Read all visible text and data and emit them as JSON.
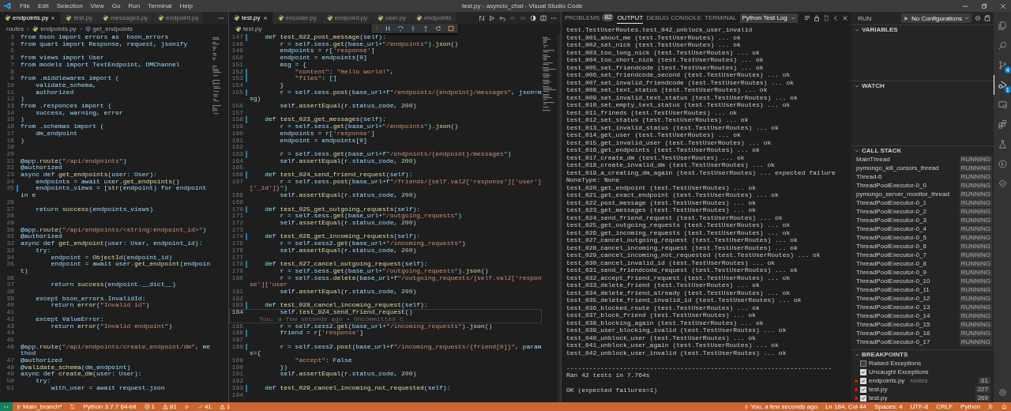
{
  "title_bar": {
    "menu": [
      "File",
      "Edit",
      "Selection",
      "View",
      "Go",
      "Run",
      "Terminal",
      "Help"
    ],
    "title": "test.py - asyncio_chat - Visual Studio Code"
  },
  "editor_groups": [
    {
      "tabs": [
        {
          "label": "endpoints.py",
          "selected": true
        },
        {
          "label": "test.py",
          "selected": false
        },
        {
          "label": "messages.py",
          "selected": false
        },
        {
          "label": "endpoint.py",
          "selected": false
        }
      ],
      "breadcrumb": [
        "routes",
        "endpoints.py",
        "get_endpoints"
      ],
      "lines": [
        {
          "n": "3",
          "text": "from bson import errors as  bson_errors",
          "modified": false,
          "current": false
        },
        {
          "n": "4",
          "text": "from quart import Response, request, jsonify",
          "modified": false,
          "current": false
        },
        {
          "n": "5",
          "modified": false,
          "current": false
        },
        {
          "n": "6",
          "text": "from views import User",
          "modified": false,
          "current": false
        },
        {
          "n": "7",
          "text": "from models import TextEndpoint, DMChannel",
          "modified": false,
          "current": false
        },
        {
          "n": "8",
          "modified": false,
          "current": false
        },
        {
          "n": "9",
          "text": "from .middlewares import (",
          "modified": false,
          "current": false
        },
        {
          "n": "10",
          "text": "    validate_schema,",
          "modified": false,
          "current": false
        },
        {
          "n": "11",
          "text": "    authorized",
          "modified": false,
          "current": false
        },
        {
          "n": "12",
          "text": ")",
          "modified": false,
          "current": false
        },
        {
          "n": "13",
          "text": "from .responces import (",
          "modified": false,
          "current": false
        },
        {
          "n": "14",
          "text": "    success, warning, error",
          "modified": false,
          "current": false
        },
        {
          "n": "15",
          "text": ")",
          "modified": false,
          "current": false
        },
        {
          "n": "16",
          "text": "from .schemas import (",
          "modified": false,
          "current": false
        },
        {
          "n": "17",
          "text": "    dm_endpoint",
          "modified": false,
          "current": false
        },
        {
          "n": "18",
          "text": ")",
          "modified": false,
          "current": false
        },
        {
          "n": "19",
          "modified": false,
          "current": false
        },
        {
          "n": "20",
          "modified": false,
          "current": false
        },
        {
          "n": "21",
          "text": "@app.route(\"/api/endpoints\")",
          "modified": false,
          "current": false
        },
        {
          "n": "22",
          "text": "@authorized",
          "modified": false,
          "current": false
        },
        {
          "n": "23",
          "text": "async def get_endpoints(user: User):",
          "modified": false,
          "current": false
        },
        {
          "n": "24",
          "text": "    endpoints = await user.get_endpoints()",
          "modified": false,
          "current": false
        },
        {
          "n": "25",
          "text": "    endpoints_views = [str(endpoint) for endpoint in e",
          "modified": true,
          "current": false
        },
        {
          "n": "26",
          "modified": false,
          "current": false
        },
        {
          "n": "27",
          "text": "    return success(endpoints_views)",
          "modified": false,
          "current": false
        },
        {
          "n": "28",
          "modified": false,
          "current": false
        },
        {
          "n": "29",
          "modified": false,
          "current": false
        },
        {
          "n": "30",
          "text": "@app.route(\"/api/endpoints/<string:endpoint_id>\")",
          "modified": false,
          "current": false
        },
        {
          "n": "31",
          "text": "@authorized",
          "modified": false,
          "current": false
        },
        {
          "n": "32",
          "text": "async def get_endpoint(user: User, endpoint_id):",
          "modified": false,
          "current": false
        },
        {
          "n": "33",
          "text": "    try:",
          "modified": false,
          "current": false
        },
        {
          "n": "34",
          "text": "        endpoint = ObjectId(endpoint_id)",
          "modified": false,
          "current": false
        },
        {
          "n": "35",
          "text": "        endpoint = await user.get_endpoint(endpoint)",
          "modified": false,
          "current": false
        },
        {
          "n": "36",
          "modified": false,
          "current": false
        },
        {
          "n": "37",
          "text": "        return success(endpoint.__dict__)",
          "modified": false,
          "current": false
        },
        {
          "n": "38",
          "modified": false,
          "current": false
        },
        {
          "n": "39",
          "text": "    except bson_errors.InvalidId:",
          "modified": false,
          "current": false
        },
        {
          "n": "40",
          "text": "        return error(\"Invalid id\")",
          "modified": false,
          "current": false
        },
        {
          "n": "41",
          "modified": false,
          "current": false
        },
        {
          "n": "42",
          "text": "    except ValueError:",
          "modified": false,
          "current": false
        },
        {
          "n": "43",
          "text": "        return error(\"Invalid endpoint\")",
          "modified": false,
          "current": false
        },
        {
          "n": "44",
          "modified": false,
          "current": false
        },
        {
          "n": "45",
          "modified": false,
          "current": false
        },
        {
          "n": "46",
          "text": "@app.route(\"/api/endpoints/create_endpoint/dm\", method",
          "modified": false,
          "current": false
        },
        {
          "n": "47",
          "text": "@authorized",
          "modified": false,
          "current": false
        },
        {
          "n": "48",
          "text": "@validate_schema(dm_endpoint)",
          "modified": false,
          "current": false
        },
        {
          "n": "49",
          "text": "async def create_dm(user: User):",
          "modified": false,
          "current": false
        },
        {
          "n": "50",
          "text": "    try:",
          "modified": false,
          "current": false
        },
        {
          "n": "51",
          "text": "        with_user = await request.json",
          "modified": false,
          "current": false
        }
      ]
    },
    {
      "tabs": [
        {
          "label": "test.py",
          "selected": true
        },
        {
          "label": "encoder.py",
          "selected": false
        },
        {
          "label": "endpoint.py",
          "selected": false
        },
        {
          "label": "user.py",
          "selected": false
        },
        {
          "label": "endpoints",
          "selected": false
        }
      ],
      "breadcrumb": [
        "test.py"
      ],
      "lines": [
        {
          "n": "147",
          "text": "    def test_022_post_message(self):",
          "modified": true,
          "current": false
        },
        {
          "n": "148",
          "text": "        r = self.sess.get(base_url+\"/endpoints\").json()",
          "modified": false,
          "current": false
        },
        {
          "n": "149",
          "text": "        endpoints = r['response']",
          "modified": false,
          "current": false
        },
        {
          "n": "150",
          "text": "        endpoint = endpoints[0]",
          "modified": false,
          "current": false
        },
        {
          "n": "151",
          "text": "        msg = {",
          "modified": false,
          "current": false
        },
        {
          "n": "152",
          "text": "            \"content\": \"Hello world!\",",
          "modified": true,
          "current": false
        },
        {
          "n": "153",
          "text": "            \"files\": []",
          "modified": true,
          "current": false
        },
        {
          "n": "154",
          "text": "        }",
          "modified": false,
          "current": false
        },
        {
          "n": "155",
          "text": "        r = self.sess.post(base_url+f\"/endpoints/{endpoint}/messages\", json=msg)",
          "modified": true,
          "current": false
        },
        {
          "n": "156",
          "text": "        self.assertEqual(r.status_code, 200)",
          "modified": false,
          "current": false
        },
        {
          "n": "157",
          "modified": false,
          "current": false
        },
        {
          "n": "158",
          "text": "    def test_023_get_messages(self):",
          "modified": true,
          "current": false
        },
        {
          "n": "159",
          "text": "        r = self.sess.get(base_url+\"/endpoints\").json()",
          "modified": false,
          "current": false
        },
        {
          "n": "160",
          "text": "        endpoints = r['response']",
          "modified": false,
          "current": false
        },
        {
          "n": "161",
          "text": "        endpoint = endpoints[0]",
          "modified": false,
          "current": false
        },
        {
          "n": "162",
          "modified": false,
          "current": false
        },
        {
          "n": "163",
          "text": "        r = self.sess.get(base_url+f\"/endpoints/{endpoint}/messages\")",
          "modified": true,
          "current": false
        },
        {
          "n": "164",
          "text": "        self.assertEqual(r.status_code, 200)",
          "modified": false,
          "current": false
        },
        {
          "n": "165",
          "modified": false,
          "current": false
        },
        {
          "n": "166",
          "text": "    def test_024_send_friend_request(self):",
          "modified": true,
          "current": false
        },
        {
          "n": "167",
          "text": "        r = self.sess.post(base_url+f\"/friends/{self.val2['response']['user']['_id']}\")",
          "modified": false,
          "current": false
        },
        {
          "n": "168",
          "text": "        self.assertEqual(r.status_code, 200)",
          "modified": false,
          "current": false
        },
        {
          "n": "169",
          "modified": false,
          "current": false
        },
        {
          "n": "170",
          "text": "    def test_025_get_outgoing_requests(self):",
          "modified": true,
          "current": false
        },
        {
          "n": "171",
          "text": "        r = self.sess.get(base_url+\"/outgoing_requests\")",
          "modified": false,
          "current": false
        },
        {
          "n": "172",
          "text": "        self.assertEqual(r.status_code, 200)",
          "modified": false,
          "current": false
        },
        {
          "n": "173",
          "modified": false,
          "current": false
        },
        {
          "n": "174",
          "text": "    def test_026_get_incoming_requests(self):",
          "modified": true,
          "current": false
        },
        {
          "n": "175",
          "text": "        r = self.sess2.get(base_url+\"/incoming_requests\")",
          "modified": false,
          "current": false
        },
        {
          "n": "176",
          "text": "        self.assertEqual(r.status_code, 200)",
          "modified": false,
          "current": false
        },
        {
          "n": "177",
          "modified": false,
          "current": false
        },
        {
          "n": "178",
          "text": "    def test_027_cancel_outgoing_request(self):",
          "modified": true,
          "current": false
        },
        {
          "n": "179",
          "text": "        r = self.sess.get(base_url+\"/outgoing_requests\").json()",
          "modified": false,
          "current": false
        },
        {
          "n": "180",
          "text": "        r = self.sess.delete(base_url+f\"/outgoing_requests/{self.val2['response']['user",
          "modified": false,
          "current": false
        },
        {
          "n": "181",
          "text": "        self.assertEqual(r.status_code, 200)",
          "modified": false,
          "current": false
        },
        {
          "n": "182",
          "modified": false,
          "current": false
        },
        {
          "n": "183",
          "text": "    def test_028_cancel_incoming_request(self):",
          "modified": true,
          "current": false
        },
        {
          "n": "184",
          "text": "        self.test_024_send_friend_request()",
          "modified": false,
          "current": true,
          "annotation": "You, a few seconds ago • Uncommitted c"
        },
        {
          "n": "185",
          "text": "        r = self.sess2.get(base_url+\"/incoming_requests\").json()",
          "modified": false,
          "current": false
        },
        {
          "n": "186",
          "text": "        friend = r['response']",
          "modified": true,
          "current": false
        },
        {
          "n": "187",
          "modified": false,
          "current": false
        },
        {
          "n": "188",
          "text": "        r = self.sess2.post(base_url+f\"/incoming_requests/{friend[0]}\", params={",
          "modified": true,
          "current": false
        },
        {
          "n": "189",
          "text": "            \"accept\": False",
          "modified": false,
          "current": false
        },
        {
          "n": "190",
          "text": "        })",
          "modified": false,
          "current": false
        },
        {
          "n": "191",
          "text": "        self.assertEqual(r.status_code, 200)",
          "modified": false,
          "current": false
        },
        {
          "n": "192",
          "modified": false,
          "current": false
        },
        {
          "n": "193",
          "text": "    def test_029_cancel_incoming_not_requested(self):",
          "modified": true,
          "current": false
        },
        {
          "n": "194",
          "modified": false,
          "current": false
        }
      ]
    }
  ],
  "panel": {
    "tabs": [
      {
        "label": "PROBLEMS",
        "badge": "82",
        "selected": false
      },
      {
        "label": "OUTPUT",
        "selected": true
      },
      {
        "label": "DEBUG CONSOLE",
        "selected": false
      },
      {
        "label": "TERMINAL",
        "selected": false
      }
    ],
    "dropdown": "Python Test Log",
    "log": [
      "test.TestUserRoutes.test_042_unblock_user_invalid",
      "test_001_about_me (test.TestUserRoutes) ... ok",
      "test_002_set_nick (test.TestUserRoutes) ... ok",
      "test_003_too_long_nick (test.TestUserRoutes) ... ok",
      "test_004_too_short_nick (test.TestUserRoutes) ... ok",
      "test_005_set_friendcode (test.TestUserRoutes) ... ok",
      "test_006_set_friendcode_second (test.TestUserRoutes) ... ok",
      "test_007_set_invalid_friendcode (test.TestUserRoutes) ... ok",
      "test_008_set_text_status (test.TestUserRoutes) ... ok",
      "test_009_set_invalid_text_status (test.TestUserRoutes) ... ok",
      "test_010_set_empty_text_status (test.TestUserRoutes) ... ok",
      "test_011_frineds (test.TestUserRoutes) ... ok",
      "test_012_set_status (test.TestUserRoutes) ... ok",
      "test_013_set_invalid_status (test.TestUserRoutes) ... ok",
      "test_014_get_user (test.TestUserRoutes) ... ok",
      "test_015_get_invalid_user (test.TestUserRoutes) ... ok",
      "test_016_get_endpoints (test.TestUserRoutes) ... ok",
      "test_017_create_dm (test.TestUserRoutes) ... ok",
      "test_018_create_invalid_dm (test.TestUserRoutes) ... ok",
      "test_019_a_creating_dm_again (test.TestUserRoutes) ... expected failure",
      "NoneType: None",
      "test_020_get_endpoint (test.TestUserRoutes) ... ok",
      "test_021_get_exact_endpoint (test.TestUserRoutes) ... ok",
      "test_022_post_message (test.TestUserRoutes) ... ok",
      "test_023_get_messages (test.TestUserRoutes) ... ok",
      "test_024_send_friend_request (test.TestUserRoutes) ... ok",
      "test_025_get_outgoing_requests (test.TestUserRoutes) ... ok",
      "test_026_get_incoming_requests (test.TestUserRoutes) ... ok",
      "test_027_cancel_outgoing_request (test.TestUserRoutes) ... ok",
      "test_028_cancel_incoming_request (test.TestUserRoutes) ... ok",
      "test_029_cancel_incoming_not_requested (test.TestUserRoutes) ... ok",
      "test_030_cancel_invalid_id (test.TestUserRoutes) ... ok",
      "test_031_send_friendcode_request (test.TestUserRoutes) ... ok",
      "test_032_accept_friend_request (test.TestUserRoutes) ... ok",
      "test_033_delete_friend (test.TestUserRoutes) ... ok",
      "test_034_delete_friend_already (test.TestUserRoutes) ... ok",
      "test_035_delete_friend_invalid_id (test.TestUserRoutes) ... ok",
      "test_036_blocked_route (test.TestUserRoutes) ... ok",
      "test_037_block_friend (test.TestUserRoutes) ... ok",
      "test_038_blocking_again (test.TestUserRoutes) ... ok",
      "test_039_user_blocking_ivalid (test.TestUserRoutes) ... ok",
      "test_040_unblock_user (test.TestUserRoutes) ... ok",
      "test_041_unblock_user_again (test.TestUserRoutes) ... ok",
      "test_042_unblock_user_invalid (test.TestUserRoutes) ... ok"
    ],
    "separator": "----------------------------------------------------------------------",
    "summary": "Ran 42 tests in 7.764s",
    "result": "OK (expected failures=1)"
  },
  "run_view": {
    "title": "RUN",
    "configuration": "No Configurations",
    "sections": [
      {
        "title": "VARIABLES",
        "expanded": true
      },
      {
        "title": "WATCH",
        "expanded": true
      }
    ],
    "call_stack": {
      "title": "CALL STACK",
      "expanded": true,
      "threads": [
        {
          "name": "MainThread",
          "status": "RUNNING"
        },
        {
          "name": "pymongo_kill_cursors_thread",
          "status": "RUNNING"
        },
        {
          "name": "Thread-6",
          "status": "RUNNING"
        },
        {
          "name": "ThreadPoolExecutor-0_0",
          "status": "RUNNING"
        },
        {
          "name": "pymongo_server_monitor_thread",
          "status": "RUNNING"
        },
        {
          "name": "ThreadPoolExecutor-0_1",
          "status": "RUNNING"
        },
        {
          "name": "ThreadPoolExecutor-0_2",
          "status": "RUNNING"
        },
        {
          "name": "ThreadPoolExecutor-0_3",
          "status": "RUNNING"
        },
        {
          "name": "ThreadPoolExecutor-0_4",
          "status": "RUNNING"
        },
        {
          "name": "ThreadPoolExecutor-0_5",
          "status": "RUNNING"
        },
        {
          "name": "ThreadPoolExecutor-0_6",
          "status": "RUNNING"
        },
        {
          "name": "ThreadPoolExecutor-0_7",
          "status": "RUNNING"
        },
        {
          "name": "ThreadPoolExecutor-0_8",
          "status": "RUNNING"
        },
        {
          "name": "ThreadPoolExecutor-0_9",
          "status": "RUNNING"
        },
        {
          "name": "ThreadPoolExecutor-0_10",
          "status": "RUNNING"
        },
        {
          "name": "ThreadPoolExecutor-0_11",
          "status": "RUNNING"
        },
        {
          "name": "ThreadPoolExecutor-0_12",
          "status": "RUNNING"
        },
        {
          "name": "ThreadPoolExecutor-0_13",
          "status": "RUNNING"
        },
        {
          "name": "ThreadPoolExecutor-0_14",
          "status": "RUNNING"
        },
        {
          "name": "ThreadPoolExecutor-0_15",
          "status": "RUNNING"
        },
        {
          "name": "ThreadPoolExecutor-0_16",
          "status": "RUNNING"
        },
        {
          "name": "ThreadPoolExecutor-0_17",
          "status": "RUNNING"
        }
      ]
    },
    "breakpoints": {
      "title": "BREAKPOINTS",
      "expanded": true,
      "items": [
        {
          "kind": "exception",
          "label": "Raised Exceptions",
          "checked": false
        },
        {
          "kind": "exception",
          "label": "Uncaught Exceptions",
          "checked": true
        },
        {
          "kind": "file",
          "label": "endpoints.py",
          "detail": "routes",
          "line": "61",
          "checked": true
        },
        {
          "kind": "file",
          "label": "test.py",
          "line": "227",
          "checked": true
        },
        {
          "kind": "file",
          "label": "test.py",
          "line": "269",
          "checked": true
        }
      ]
    }
  },
  "activity_bar": {
    "items": [
      {
        "kind": "files",
        "selected": false
      },
      {
        "kind": "search",
        "selected": false
      },
      {
        "kind": "scm",
        "selected": false,
        "badge": "4"
      },
      {
        "kind": "debug",
        "selected": true,
        "badge": "1"
      },
      {
        "kind": "remote",
        "selected": false
      },
      {
        "kind": "extensions",
        "selected": false
      },
      {
        "kind": "testing",
        "selected": false
      },
      {
        "kind": "timeline",
        "selected": false
      },
      {
        "kind": "liveshare",
        "selected": false
      }
    ],
    "bottom": [
      {
        "kind": "settings",
        "selected": false
      }
    ]
  },
  "status_bar": {
    "left": [
      {
        "kind": "remote"
      },
      {
        "kind": "branch",
        "text": "Main_branch*"
      },
      {
        "kind": "sync"
      },
      {
        "kind": "text",
        "text": "Python 3.7.7 64-bit"
      },
      {
        "kind": "errors",
        "text": "1"
      },
      {
        "kind": "warnings",
        "text": "81"
      },
      {
        "kind": "play"
      },
      {
        "kind": "tests",
        "text": "41"
      },
      {
        "kind": "warnings",
        "text": "1"
      }
    ],
    "right": [
      {
        "kind": "blame",
        "text": "You, a few seconds ago"
      },
      {
        "kind": "text",
        "text": "Ln 184, Col 44"
      },
      {
        "kind": "text",
        "text": "Spaces: 4"
      },
      {
        "kind": "text",
        "text": "UTF-8"
      },
      {
        "kind": "text",
        "text": "CRLF"
      },
      {
        "kind": "text",
        "text": "Python"
      },
      {
        "kind": "feedback"
      },
      {
        "kind": "bell"
      }
    ]
  }
}
